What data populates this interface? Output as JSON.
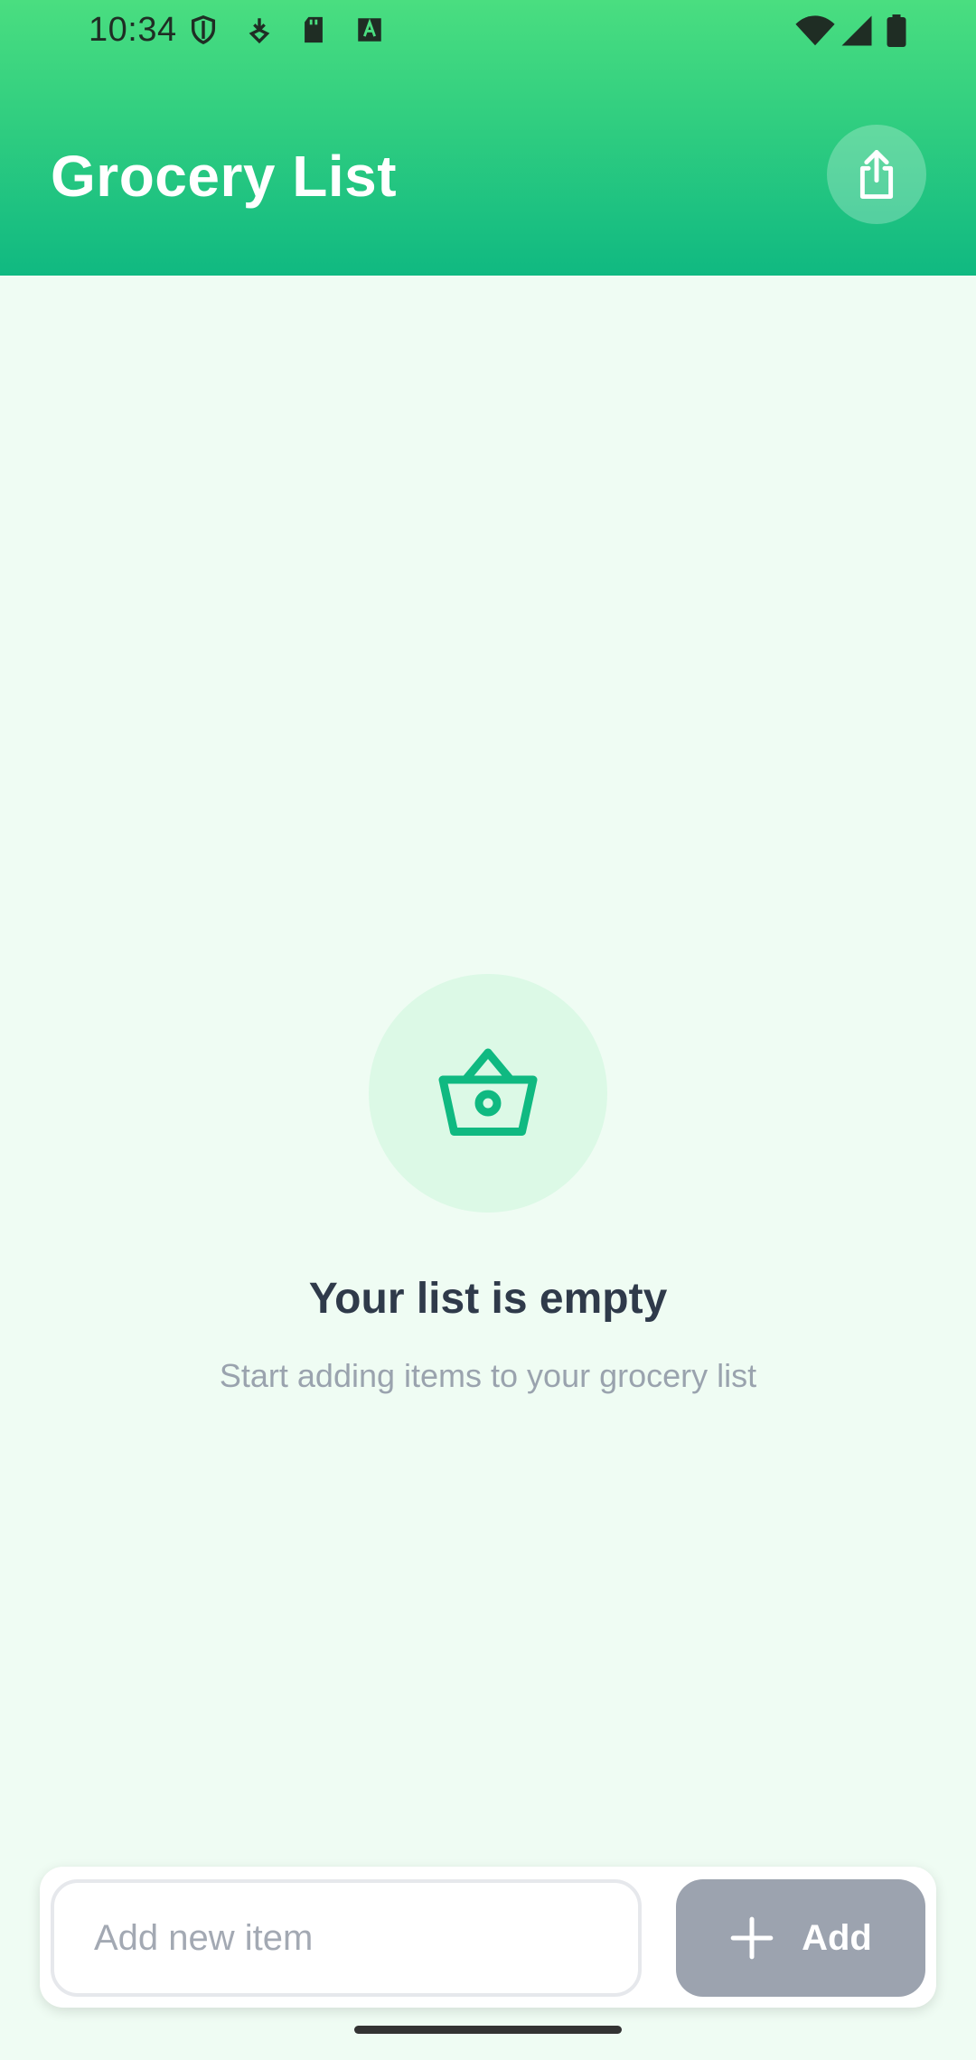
{
  "status_bar": {
    "time": "10:34",
    "icons": [
      "shield-icon",
      "download-icon",
      "sd-card-icon",
      "font-icon",
      "wifi-icon",
      "signal-icon",
      "battery-icon"
    ]
  },
  "header": {
    "title": "Grocery List",
    "share_icon": "share-icon"
  },
  "empty_state": {
    "icon": "basket-icon",
    "title": "Your list is empty",
    "subtitle": "Start adding items to your grocery list"
  },
  "input_bar": {
    "placeholder": "Add new item",
    "value": "",
    "add_label": "Add",
    "add_icon": "plus-icon"
  },
  "colors": {
    "header_gradient_top": "#4ade80",
    "header_gradient_bottom": "#10b981",
    "background": "#effcf3",
    "accent": "#10b981",
    "add_button": "#9ca3af"
  }
}
